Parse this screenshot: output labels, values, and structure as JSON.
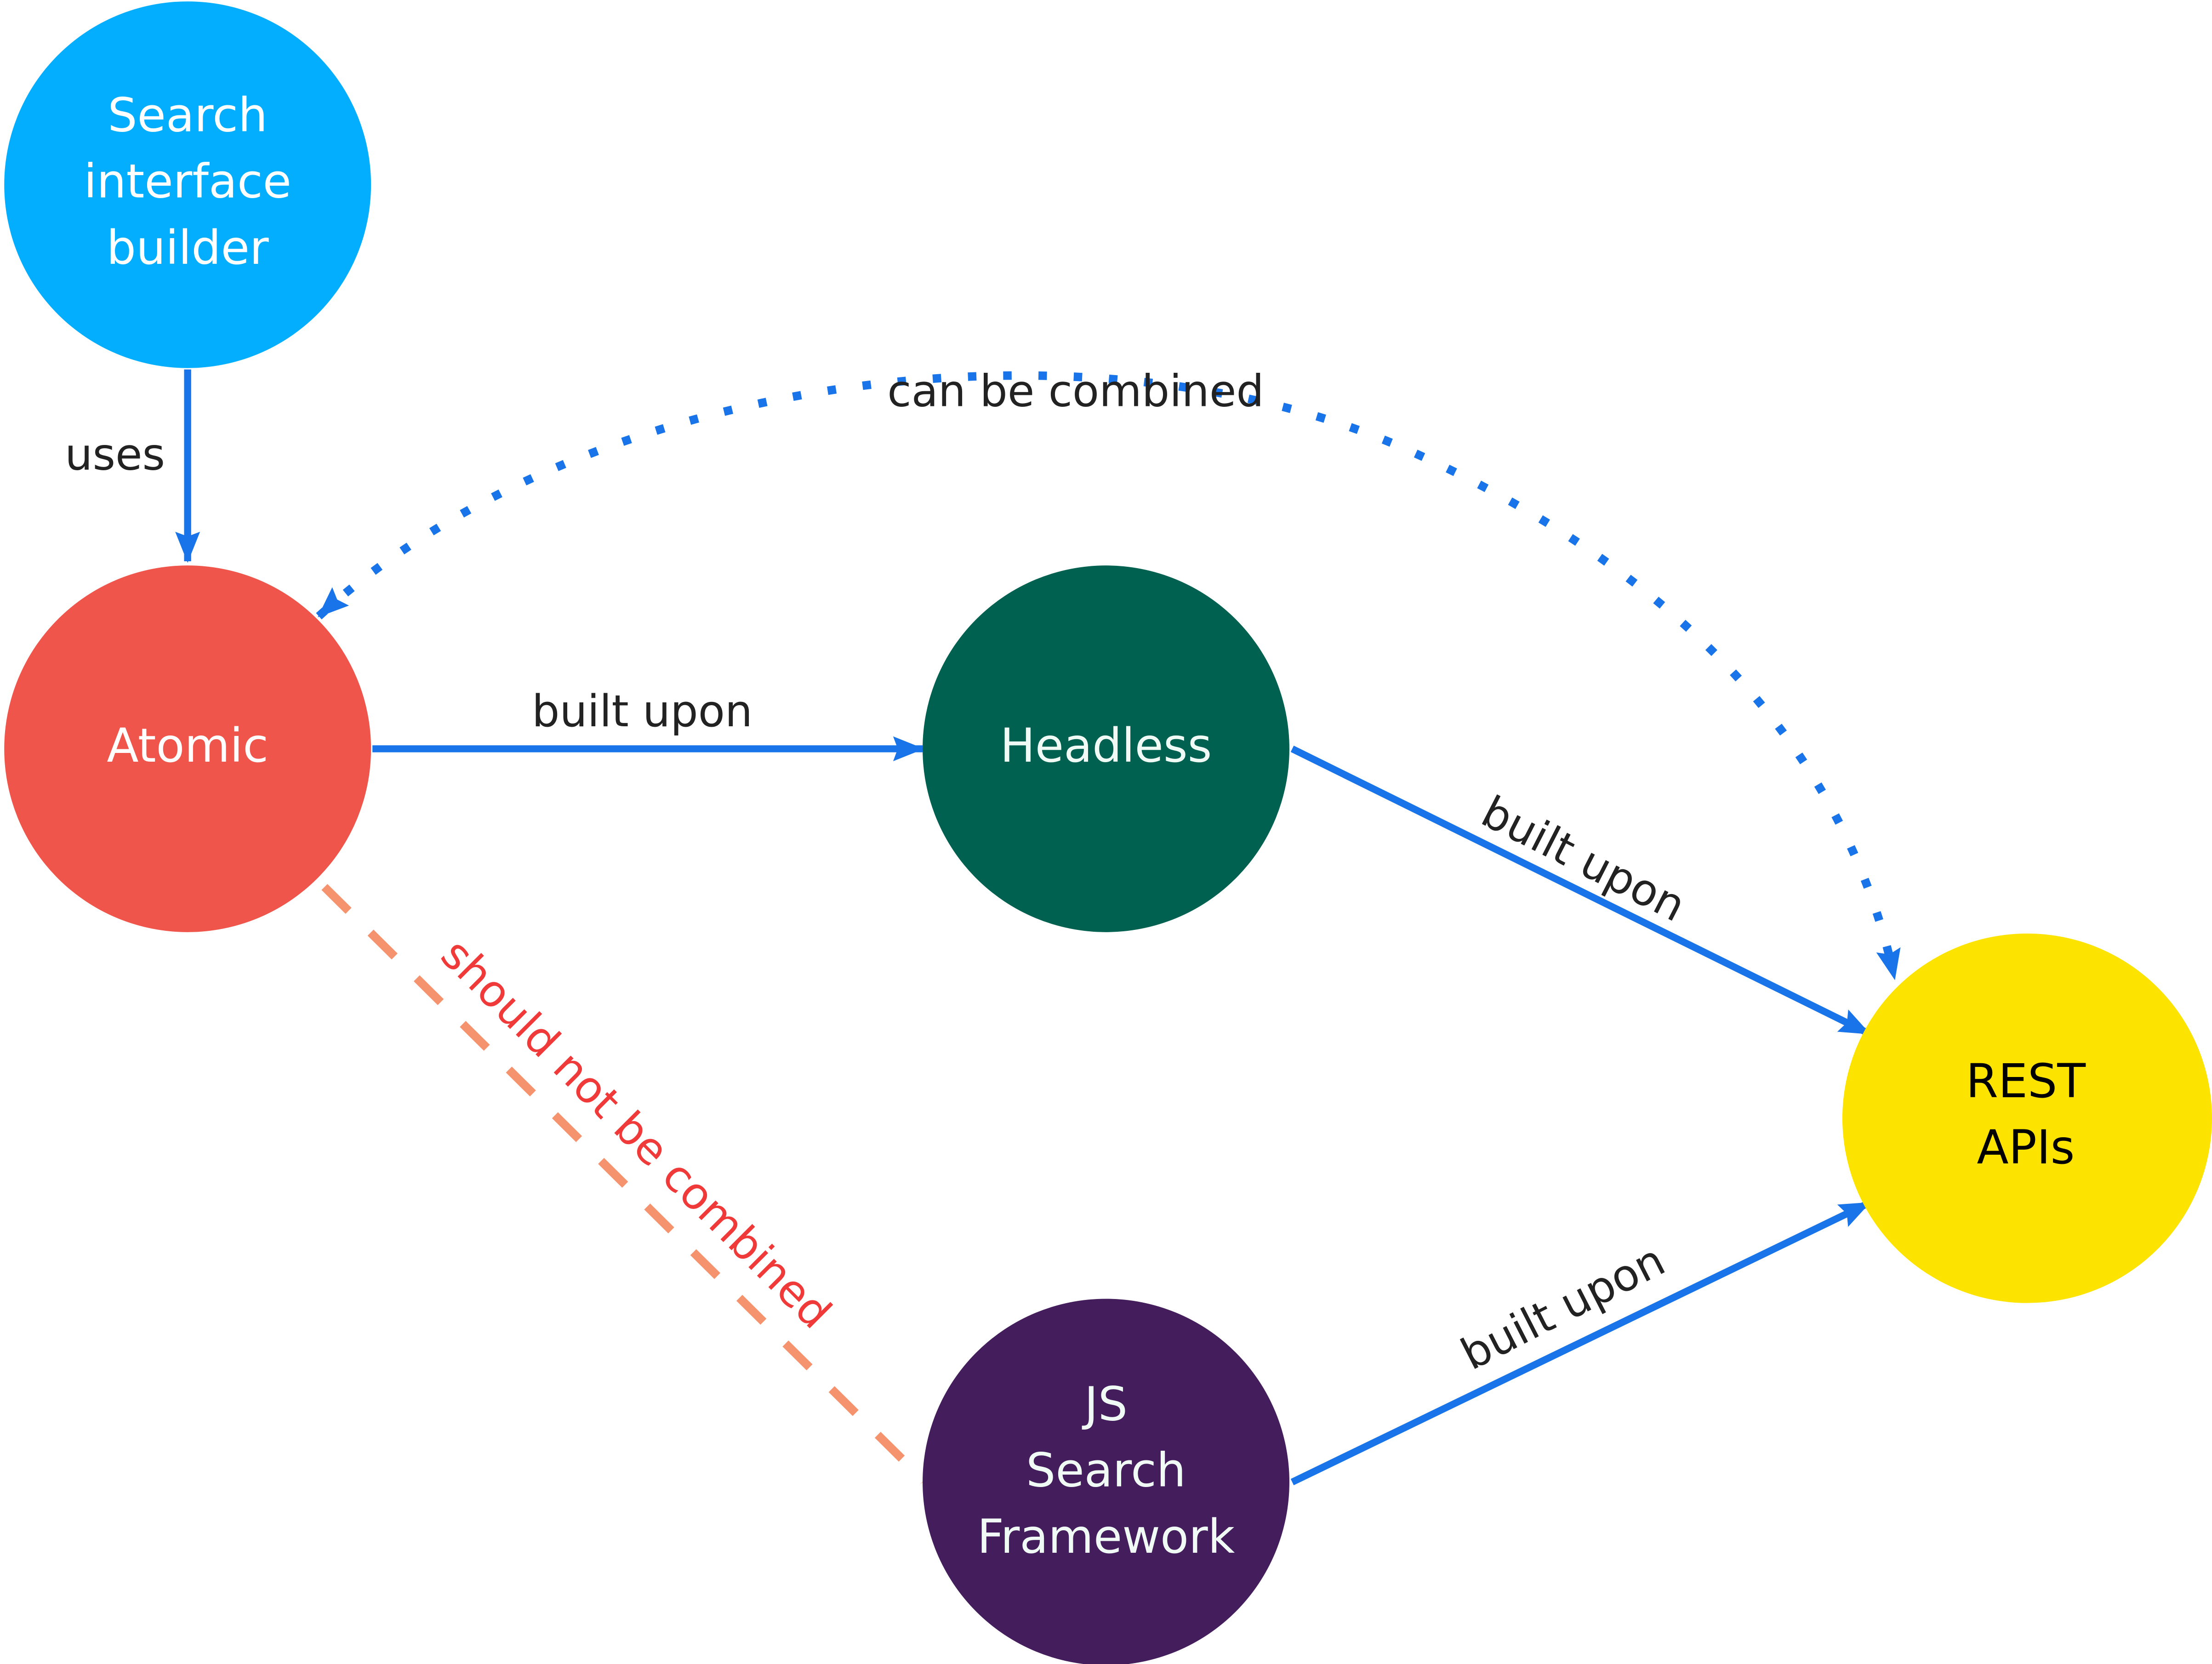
{
  "diagram": {
    "type": "concept-map",
    "nodes": [
      {
        "id": "search-interface-builder",
        "lines": [
          "Search",
          "interface",
          "builder"
        ],
        "fill": "#03aeff",
        "text_color": "#ffffff"
      },
      {
        "id": "atomic",
        "lines": [
          "Atomic"
        ],
        "fill": "#ef554a",
        "text_color": "#ffffff"
      },
      {
        "id": "headless",
        "lines": [
          "Headless"
        ],
        "fill": "#006150",
        "text_color": "#f0fbf6"
      },
      {
        "id": "rest-apis",
        "lines": [
          "REST",
          "APIs"
        ],
        "fill": "#fde400",
        "text_color": "#000000"
      },
      {
        "id": "js-search-framework",
        "lines": [
          "JS",
          "Search",
          "Framework"
        ],
        "fill": "#441e5c",
        "text_color": "#f0fbf6"
      }
    ],
    "edges": [
      {
        "id": "uses",
        "from": "search-interface-builder",
        "to": "atomic",
        "label": "uses",
        "style": "solid",
        "color": "#1874e8",
        "label_color": "#222222"
      },
      {
        "id": "atomic-headless",
        "from": "atomic",
        "to": "headless",
        "label": "built upon",
        "style": "solid",
        "color": "#1874e8",
        "label_color": "#222222"
      },
      {
        "id": "headless-rest",
        "from": "headless",
        "to": "rest-apis",
        "label": "built upon",
        "style": "solid",
        "color": "#1874e8",
        "label_color": "#222222"
      },
      {
        "id": "jsf-rest",
        "from": "js-search-framework",
        "to": "rest-apis",
        "label": "built upon",
        "style": "solid",
        "color": "#1874e8",
        "label_color": "#222222"
      },
      {
        "id": "can-combine",
        "from": "atomic",
        "to": "rest-apis",
        "label": "can be combined",
        "style": "dotted",
        "bidirectional": true,
        "color": "#1874e8",
        "label_color": "#222222"
      },
      {
        "id": "should-not-combine",
        "from": "atomic",
        "to": "js-search-framework",
        "label": "should not be combined",
        "style": "dashed",
        "color": "#f5936e",
        "label_color": "#f03a3a"
      }
    ]
  }
}
